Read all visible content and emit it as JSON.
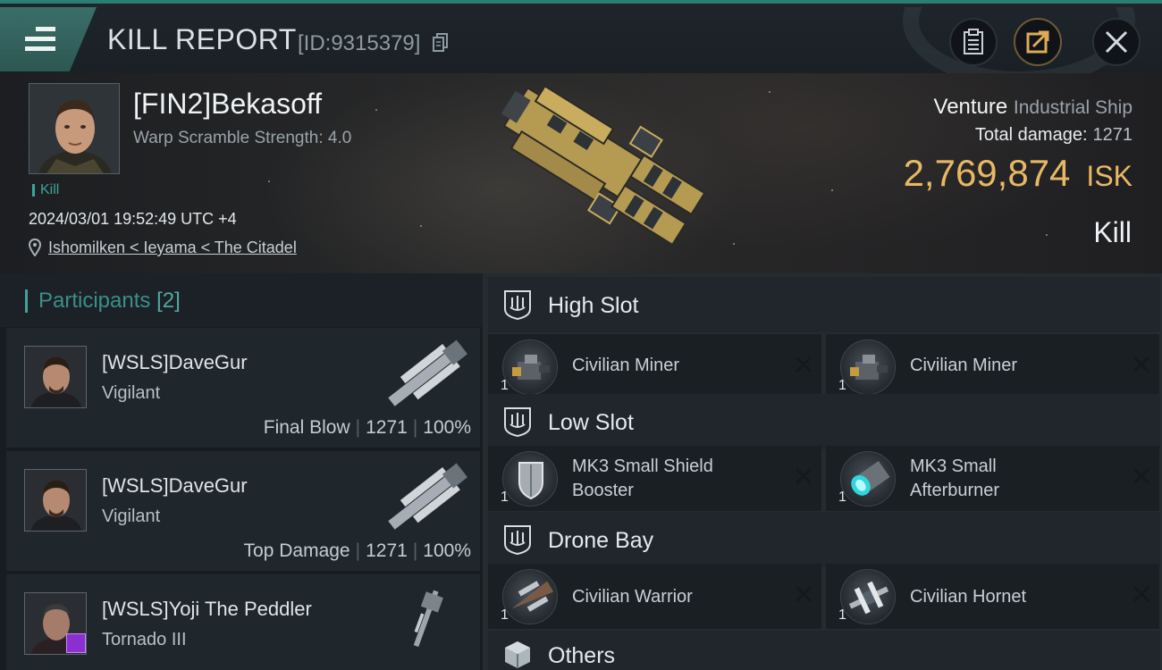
{
  "header": {
    "title": "KILL REPORT",
    "report_id": "[ID:9315379]"
  },
  "victim": {
    "name": "[FIN2]Bekasoff",
    "warp_scramble": "Warp Scramble Strength: 4.0",
    "kill_tag": "Kill",
    "timestamp": "2024/03/01 19:52:49 UTC +4",
    "location": "Ishomilken < Ieyama < The Citadel",
    "ship_name": "Venture",
    "ship_class": "Industrial Ship",
    "total_damage_label": "Total damage:",
    "total_damage": "1271",
    "isk_value": "2,769,874",
    "isk_label": "ISK",
    "result": "Kill"
  },
  "participants": {
    "title": "Participants",
    "count": "[2]",
    "rows": [
      {
        "name": "[WSLS]DaveGur",
        "ship": "Vigilant",
        "tag": "Final Blow",
        "damage": "1271",
        "percent": "100%"
      },
      {
        "name": "[WSLS]DaveGur",
        "ship": "Vigilant",
        "tag": "Top Damage",
        "damage": "1271",
        "percent": "100%"
      },
      {
        "name": "[WSLS]Yoji The Peddler",
        "ship": "Tornado III"
      }
    ]
  },
  "fitting": {
    "sections": [
      {
        "label": "High Slot",
        "modules": [
          {
            "name": "Civilian Miner",
            "qty": "1"
          },
          {
            "name": "Civilian Miner",
            "qty": "1"
          }
        ]
      },
      {
        "label": "Low Slot",
        "modules": [
          {
            "name": "MK3 Small Shield Booster",
            "line1": "MK3 Small Shield",
            "line2": "Booster",
            "qty": "1"
          },
          {
            "name": "MK3 Small Afterburner",
            "line1": "MK3 Small",
            "line2": "Afterburner",
            "qty": "1"
          }
        ]
      },
      {
        "label": "Drone Bay",
        "modules": [
          {
            "name": "Civilian Warrior",
            "qty": "1"
          },
          {
            "name": "Civilian Hornet",
            "qty": "1"
          }
        ]
      },
      {
        "label": "Others",
        "modules": []
      }
    ]
  },
  "icons": {
    "menu": "hamburger-menu-icon",
    "copy": "copy-icon",
    "clipboard": "clipboard-icon",
    "share": "share-icon",
    "close": "close-icon",
    "location": "location-pin-icon",
    "slot": "slot-shield-icon",
    "others": "cube-icon",
    "remove": "x-icon"
  },
  "colors": {
    "accent_teal": "#3fa39a",
    "isk_gold": "#e8b964",
    "corp_badge": "#8a2fd0"
  }
}
